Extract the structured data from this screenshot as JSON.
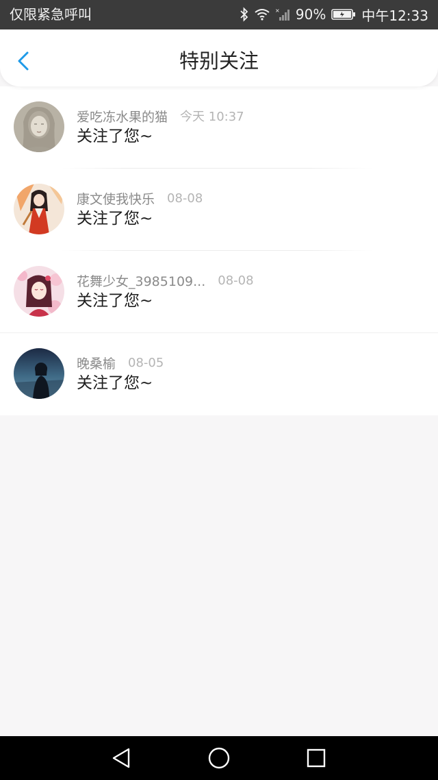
{
  "status_bar": {
    "carrier_text": "仅限紧急呼叫",
    "battery": "90%",
    "time": "中午12:33",
    "icons": [
      "bluetooth-icon",
      "wifi-icon",
      "signal-icon",
      "battery-icon"
    ]
  },
  "header": {
    "title": "特别关注",
    "back_icon": "chevron-left-icon"
  },
  "list": {
    "items": [
      {
        "name": "爱吃冻水果的猫",
        "time": "今天 10:37",
        "message": "关注了您~"
      },
      {
        "name": "康文使我快乐",
        "time": "08-08",
        "message": "关注了您~"
      },
      {
        "name": "花舞少女_3985109...",
        "time": "08-08",
        "message": "关注了您~"
      },
      {
        "name": "晚桑榆",
        "time": "08-05",
        "message": "关注了您~"
      }
    ]
  },
  "nav_bar": {
    "icons": [
      "back-triangle-icon",
      "home-circle-icon",
      "recents-square-icon"
    ]
  },
  "colors": {
    "accent": "#1e9ae8",
    "status_bar_bg": "#3b3b3b",
    "page_bg": "#f7f6f7"
  }
}
